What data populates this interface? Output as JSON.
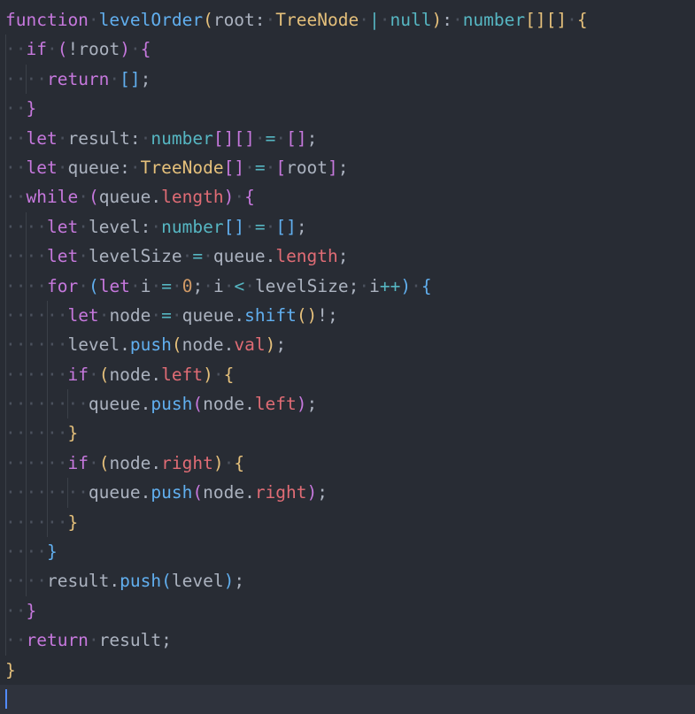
{
  "editor": {
    "language": "typescript",
    "background_color": "#282c34",
    "foreground_color": "#abb2bf",
    "active_line_color": "#2f333d",
    "cursor_color": "#528bff",
    "indent_guide_color": "#3b4048",
    "whitespace_dot_color": "#4b515d",
    "whitespace_dot": "·",
    "cursor_line": 22,
    "total_lines": 22,
    "palette": {
      "keyword": "#c678dd",
      "function": "#61afef",
      "type": "#e5c07b",
      "builtin_type": "#56b6c2",
      "operator": "#56b6c2",
      "number": "#d19a66",
      "property": "#e06c75",
      "plain": "#abb2bf",
      "bracket_depth_1": "#e5c07b",
      "bracket_depth_2": "#c678dd",
      "bracket_depth_3": "#61afef"
    }
  },
  "code": {
    "function_name": "levelOrder",
    "full_text": "function levelOrder(root: TreeNode | null): number[][] {\n  if (!root) {\n    return [];\n  }\n  let result: number[][] = [];\n  let queue: TreeNode[] = [root];\n  while (queue.length) {\n    let level: number[] = [];\n    let levelSize = queue.length;\n    for (let i = 0; i < levelSize; i++) {\n      let node = queue.shift()!;\n      level.push(node.val);\n      if (node.left) {\n        queue.push(node.left);\n      }\n      if (node.right) {\n        queue.push(node.right);\n      }\n    }\n    result.push(level);\n  }\n  return result;\n}\n",
    "lines": [
      {
        "n": 1,
        "indent": 0,
        "text": "function levelOrder(root: TreeNode | null): number[][] {",
        "tokens": [
          {
            "t": "function",
            "c": "kw"
          },
          {
            "t": " ",
            "c": "ws-space"
          },
          {
            "t": "levelOrder",
            "c": "fn"
          },
          {
            "t": "(",
            "c": "b1"
          },
          {
            "t": "root",
            "c": "plain"
          },
          {
            "t": ":",
            "c": "plain"
          },
          {
            "t": " ",
            "c": "ws-space"
          },
          {
            "t": "TreeNode",
            "c": "type"
          },
          {
            "t": " ",
            "c": "ws-space"
          },
          {
            "t": "|",
            "c": "builtin"
          },
          {
            "t": " ",
            "c": "ws-space"
          },
          {
            "t": "null",
            "c": "builtin"
          },
          {
            "t": ")",
            "c": "b1"
          },
          {
            "t": ":",
            "c": "plain"
          },
          {
            "t": " ",
            "c": "ws-space"
          },
          {
            "t": "number",
            "c": "builtin"
          },
          {
            "t": "[]",
            "c": "b1"
          },
          {
            "t": "[]",
            "c": "b1"
          },
          {
            "t": " ",
            "c": "ws-space"
          },
          {
            "t": "{",
            "c": "b1"
          }
        ]
      },
      {
        "n": 2,
        "indent": 1,
        "text": "  if (!root) {",
        "tokens": [
          {
            "t": "if",
            "c": "kw"
          },
          {
            "t": " ",
            "c": "ws-space"
          },
          {
            "t": "(",
            "c": "b2"
          },
          {
            "t": "!",
            "c": "plain"
          },
          {
            "t": "root",
            "c": "plain"
          },
          {
            "t": ")",
            "c": "b2"
          },
          {
            "t": " ",
            "c": "ws-space"
          },
          {
            "t": "{",
            "c": "b2"
          }
        ]
      },
      {
        "n": 3,
        "indent": 2,
        "text": "    return [];",
        "tokens": [
          {
            "t": "return",
            "c": "kw"
          },
          {
            "t": " ",
            "c": "ws-space"
          },
          {
            "t": "[]",
            "c": "b3"
          },
          {
            "t": ";",
            "c": "plain"
          }
        ]
      },
      {
        "n": 4,
        "indent": 1,
        "text": "  }",
        "tokens": [
          {
            "t": "}",
            "c": "b2"
          }
        ]
      },
      {
        "n": 5,
        "indent": 1,
        "text": "  let result: number[][] = [];",
        "tokens": [
          {
            "t": "let",
            "c": "kw"
          },
          {
            "t": " ",
            "c": "ws-space"
          },
          {
            "t": "result",
            "c": "plain"
          },
          {
            "t": ":",
            "c": "plain"
          },
          {
            "t": " ",
            "c": "ws-space"
          },
          {
            "t": "number",
            "c": "builtin"
          },
          {
            "t": "[]",
            "c": "b2"
          },
          {
            "t": "[]",
            "c": "b2"
          },
          {
            "t": " ",
            "c": "ws-space"
          },
          {
            "t": "=",
            "c": "op"
          },
          {
            "t": " ",
            "c": "ws-space"
          },
          {
            "t": "[]",
            "c": "b2"
          },
          {
            "t": ";",
            "c": "plain"
          }
        ]
      },
      {
        "n": 6,
        "indent": 1,
        "text": "  let queue: TreeNode[] = [root];",
        "tokens": [
          {
            "t": "let",
            "c": "kw"
          },
          {
            "t": " ",
            "c": "ws-space"
          },
          {
            "t": "queue",
            "c": "plain"
          },
          {
            "t": ":",
            "c": "plain"
          },
          {
            "t": " ",
            "c": "ws-space"
          },
          {
            "t": "TreeNode",
            "c": "type"
          },
          {
            "t": "[]",
            "c": "b2"
          },
          {
            "t": " ",
            "c": "ws-space"
          },
          {
            "t": "=",
            "c": "op"
          },
          {
            "t": " ",
            "c": "ws-space"
          },
          {
            "t": "[",
            "c": "b2"
          },
          {
            "t": "root",
            "c": "plain"
          },
          {
            "t": "]",
            "c": "b2"
          },
          {
            "t": ";",
            "c": "plain"
          }
        ]
      },
      {
        "n": 7,
        "indent": 1,
        "text": "  while (queue.length) {",
        "tokens": [
          {
            "t": "while",
            "c": "kw"
          },
          {
            "t": " ",
            "c": "ws-space"
          },
          {
            "t": "(",
            "c": "b2"
          },
          {
            "t": "queue",
            "c": "plain"
          },
          {
            "t": ".",
            "c": "plain"
          },
          {
            "t": "length",
            "c": "prop"
          },
          {
            "t": ")",
            "c": "b2"
          },
          {
            "t": " ",
            "c": "ws-space"
          },
          {
            "t": "{",
            "c": "b2"
          }
        ]
      },
      {
        "n": 8,
        "indent": 2,
        "text": "    let level: number[] = [];",
        "tokens": [
          {
            "t": "let",
            "c": "kw"
          },
          {
            "t": " ",
            "c": "ws-space"
          },
          {
            "t": "level",
            "c": "plain"
          },
          {
            "t": ":",
            "c": "plain"
          },
          {
            "t": " ",
            "c": "ws-space"
          },
          {
            "t": "number",
            "c": "builtin"
          },
          {
            "t": "[]",
            "c": "b3"
          },
          {
            "t": " ",
            "c": "ws-space"
          },
          {
            "t": "=",
            "c": "op"
          },
          {
            "t": " ",
            "c": "ws-space"
          },
          {
            "t": "[]",
            "c": "b3"
          },
          {
            "t": ";",
            "c": "plain"
          }
        ]
      },
      {
        "n": 9,
        "indent": 2,
        "text": "    let levelSize = queue.length;",
        "tokens": [
          {
            "t": "let",
            "c": "kw"
          },
          {
            "t": " ",
            "c": "ws-space"
          },
          {
            "t": "levelSize",
            "c": "plain"
          },
          {
            "t": " ",
            "c": "ws-space"
          },
          {
            "t": "=",
            "c": "op"
          },
          {
            "t": " ",
            "c": "ws-space"
          },
          {
            "t": "queue",
            "c": "plain"
          },
          {
            "t": ".",
            "c": "plain"
          },
          {
            "t": "length",
            "c": "prop"
          },
          {
            "t": ";",
            "c": "plain"
          }
        ]
      },
      {
        "n": 10,
        "indent": 2,
        "text": "    for (let i = 0; i < levelSize; i++) {",
        "tokens": [
          {
            "t": "for",
            "c": "kw"
          },
          {
            "t": " ",
            "c": "ws-space"
          },
          {
            "t": "(",
            "c": "b3"
          },
          {
            "t": "let",
            "c": "kw"
          },
          {
            "t": " ",
            "c": "ws-space"
          },
          {
            "t": "i",
            "c": "plain"
          },
          {
            "t": " ",
            "c": "ws-space"
          },
          {
            "t": "=",
            "c": "op"
          },
          {
            "t": " ",
            "c": "ws-space"
          },
          {
            "t": "0",
            "c": "num"
          },
          {
            "t": ";",
            "c": "plain"
          },
          {
            "t": " ",
            "c": "ws-space"
          },
          {
            "t": "i",
            "c": "plain"
          },
          {
            "t": " ",
            "c": "ws-space"
          },
          {
            "t": "<",
            "c": "op"
          },
          {
            "t": " ",
            "c": "ws-space"
          },
          {
            "t": "levelSize",
            "c": "plain"
          },
          {
            "t": ";",
            "c": "plain"
          },
          {
            "t": " ",
            "c": "ws-space"
          },
          {
            "t": "i",
            "c": "plain"
          },
          {
            "t": "++",
            "c": "op"
          },
          {
            "t": ")",
            "c": "b3"
          },
          {
            "t": " ",
            "c": "ws-space"
          },
          {
            "t": "{",
            "c": "b3"
          }
        ]
      },
      {
        "n": 11,
        "indent": 3,
        "text": "      let node = queue.shift()!;",
        "tokens": [
          {
            "t": "let",
            "c": "kw"
          },
          {
            "t": " ",
            "c": "ws-space"
          },
          {
            "t": "node",
            "c": "plain"
          },
          {
            "t": " ",
            "c": "ws-space"
          },
          {
            "t": "=",
            "c": "op"
          },
          {
            "t": " ",
            "c": "ws-space"
          },
          {
            "t": "queue",
            "c": "plain"
          },
          {
            "t": ".",
            "c": "plain"
          },
          {
            "t": "shift",
            "c": "fn"
          },
          {
            "t": "()",
            "c": "b1"
          },
          {
            "t": "!",
            "c": "plain"
          },
          {
            "t": ";",
            "c": "plain"
          }
        ]
      },
      {
        "n": 12,
        "indent": 3,
        "text": "      level.push(node.val);",
        "tokens": [
          {
            "t": "level",
            "c": "plain"
          },
          {
            "t": ".",
            "c": "plain"
          },
          {
            "t": "push",
            "c": "fn"
          },
          {
            "t": "(",
            "c": "b1"
          },
          {
            "t": "node",
            "c": "plain"
          },
          {
            "t": ".",
            "c": "plain"
          },
          {
            "t": "val",
            "c": "prop"
          },
          {
            "t": ")",
            "c": "b1"
          },
          {
            "t": ";",
            "c": "plain"
          }
        ]
      },
      {
        "n": 13,
        "indent": 3,
        "text": "      if (node.left) {",
        "tokens": [
          {
            "t": "if",
            "c": "kw"
          },
          {
            "t": " ",
            "c": "ws-space"
          },
          {
            "t": "(",
            "c": "b1"
          },
          {
            "t": "node",
            "c": "plain"
          },
          {
            "t": ".",
            "c": "plain"
          },
          {
            "t": "left",
            "c": "prop"
          },
          {
            "t": ")",
            "c": "b1"
          },
          {
            "t": " ",
            "c": "ws-space"
          },
          {
            "t": "{",
            "c": "b1"
          }
        ]
      },
      {
        "n": 14,
        "indent": 4,
        "text": "        queue.push(node.left);",
        "tokens": [
          {
            "t": "queue",
            "c": "plain"
          },
          {
            "t": ".",
            "c": "plain"
          },
          {
            "t": "push",
            "c": "fn"
          },
          {
            "t": "(",
            "c": "b2"
          },
          {
            "t": "node",
            "c": "plain"
          },
          {
            "t": ".",
            "c": "plain"
          },
          {
            "t": "left",
            "c": "prop"
          },
          {
            "t": ")",
            "c": "b2"
          },
          {
            "t": ";",
            "c": "plain"
          }
        ]
      },
      {
        "n": 15,
        "indent": 3,
        "text": "      }",
        "tokens": [
          {
            "t": "}",
            "c": "b1"
          }
        ]
      },
      {
        "n": 16,
        "indent": 3,
        "text": "      if (node.right) {",
        "tokens": [
          {
            "t": "if",
            "c": "kw"
          },
          {
            "t": " ",
            "c": "ws-space"
          },
          {
            "t": "(",
            "c": "b1"
          },
          {
            "t": "node",
            "c": "plain"
          },
          {
            "t": ".",
            "c": "plain"
          },
          {
            "t": "right",
            "c": "prop"
          },
          {
            "t": ")",
            "c": "b1"
          },
          {
            "t": " ",
            "c": "ws-space"
          },
          {
            "t": "{",
            "c": "b1"
          }
        ]
      },
      {
        "n": 17,
        "indent": 4,
        "text": "        queue.push(node.right);",
        "tokens": [
          {
            "t": "queue",
            "c": "plain"
          },
          {
            "t": ".",
            "c": "plain"
          },
          {
            "t": "push",
            "c": "fn"
          },
          {
            "t": "(",
            "c": "b2"
          },
          {
            "t": "node",
            "c": "plain"
          },
          {
            "t": ".",
            "c": "plain"
          },
          {
            "t": "right",
            "c": "prop"
          },
          {
            "t": ")",
            "c": "b2"
          },
          {
            "t": ";",
            "c": "plain"
          }
        ]
      },
      {
        "n": 18,
        "indent": 3,
        "text": "      }",
        "tokens": [
          {
            "t": "}",
            "c": "b1"
          }
        ]
      },
      {
        "n": 19,
        "indent": 2,
        "text": "    }",
        "tokens": [
          {
            "t": "}",
            "c": "b3"
          }
        ]
      },
      {
        "n": 20,
        "indent": 2,
        "text": "    result.push(level);",
        "tokens": [
          {
            "t": "result",
            "c": "plain"
          },
          {
            "t": ".",
            "c": "plain"
          },
          {
            "t": "push",
            "c": "fn"
          },
          {
            "t": "(",
            "c": "b3"
          },
          {
            "t": "level",
            "c": "plain"
          },
          {
            "t": ")",
            "c": "b3"
          },
          {
            "t": ";",
            "c": "plain"
          }
        ]
      },
      {
        "n": 21,
        "indent": 1,
        "text": "  }",
        "tokens": [
          {
            "t": "}",
            "c": "b2"
          }
        ]
      },
      {
        "n": 22,
        "indent": 1,
        "text": "  return result;",
        "tokens": [
          {
            "t": "return",
            "c": "kw"
          },
          {
            "t": " ",
            "c": "ws-space"
          },
          {
            "t": "result",
            "c": "plain"
          },
          {
            "t": ";",
            "c": "plain"
          }
        ]
      },
      {
        "n": 23,
        "indent": 0,
        "text": "}",
        "tokens": [
          {
            "t": "}",
            "c": "b1"
          }
        ]
      },
      {
        "n": 24,
        "indent": 0,
        "text": "",
        "cursor": true,
        "tokens": []
      }
    ]
  }
}
